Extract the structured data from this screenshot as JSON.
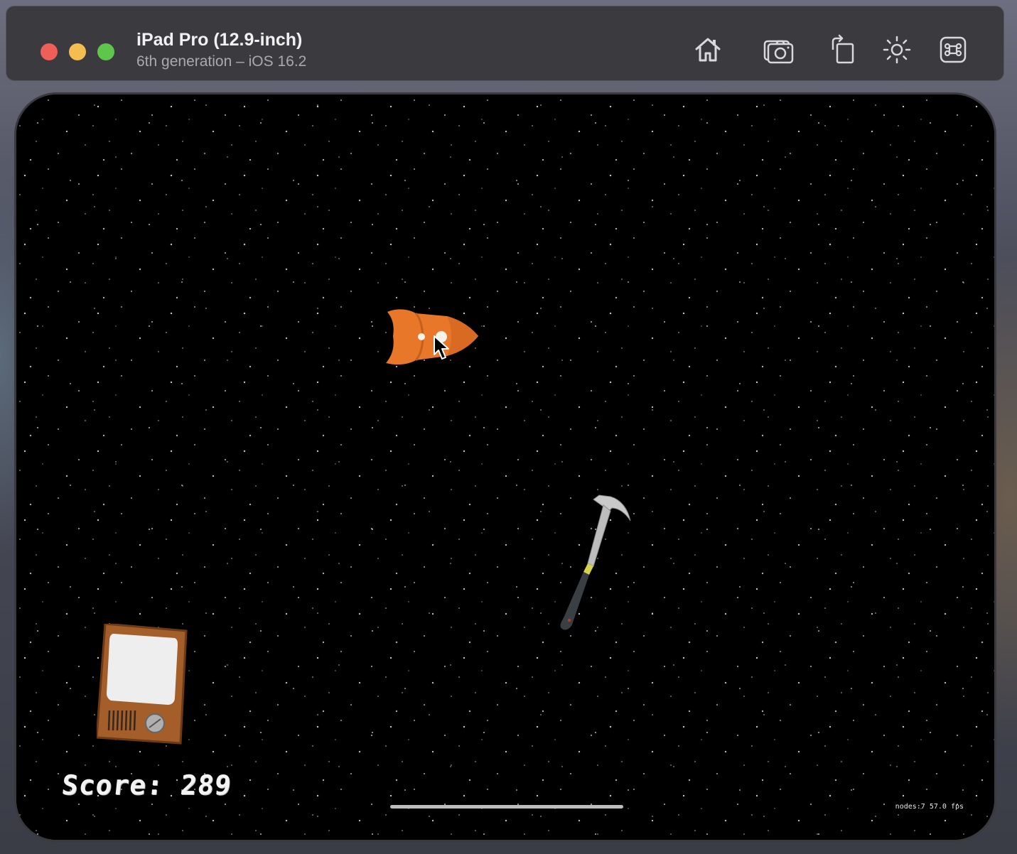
{
  "window": {
    "title": "iPad Pro (12.9-inch)",
    "subtitle": "6th generation – iOS 16.2"
  },
  "toolbar": {
    "icons": [
      "home-icon",
      "screenshot-camera-icon",
      "rotate-icon",
      "appearance-sun-icon",
      "command-key-icon"
    ]
  },
  "game": {
    "score_text": "Score: 289",
    "stats_text": "nodes:7  57.0 fps",
    "sprites": [
      "rocket",
      "hammer",
      "tv"
    ]
  },
  "colors": {
    "titlebar": "#3b3b3f",
    "rocket": "#e8772a",
    "background": "#000000"
  }
}
